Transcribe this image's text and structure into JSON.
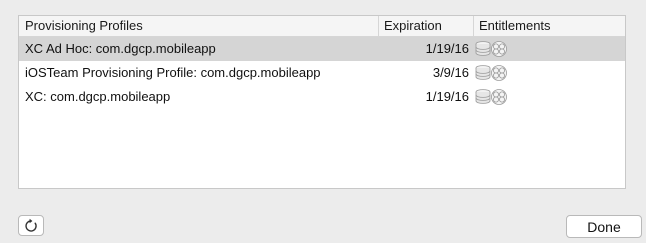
{
  "table": {
    "columns": {
      "name": "Provisioning Profiles",
      "expiration": "Expiration",
      "entitlements": "Entitlements"
    },
    "rows": [
      {
        "name": "XC Ad Hoc: com.dgcp.mobileapp",
        "expiration": "1/19/16",
        "entitlements_icon": "entitlements-icon",
        "selected": true
      },
      {
        "name": "iOSTeam Provisioning Profile: com.dgcp.mobileapp",
        "expiration": "3/9/16",
        "entitlements_icon": "entitlements-icon",
        "selected": false
      },
      {
        "name": "XC: com.dgcp.mobileapp",
        "expiration": "1/19/16",
        "entitlements_icon": "entitlements-icon",
        "selected": false
      }
    ]
  },
  "footer": {
    "refresh_icon": "refresh-icon",
    "done_label": "Done"
  },
  "colors": {
    "background": "#ececec",
    "selected_row": "#d5d5d5",
    "border": "#c8c8c8"
  }
}
